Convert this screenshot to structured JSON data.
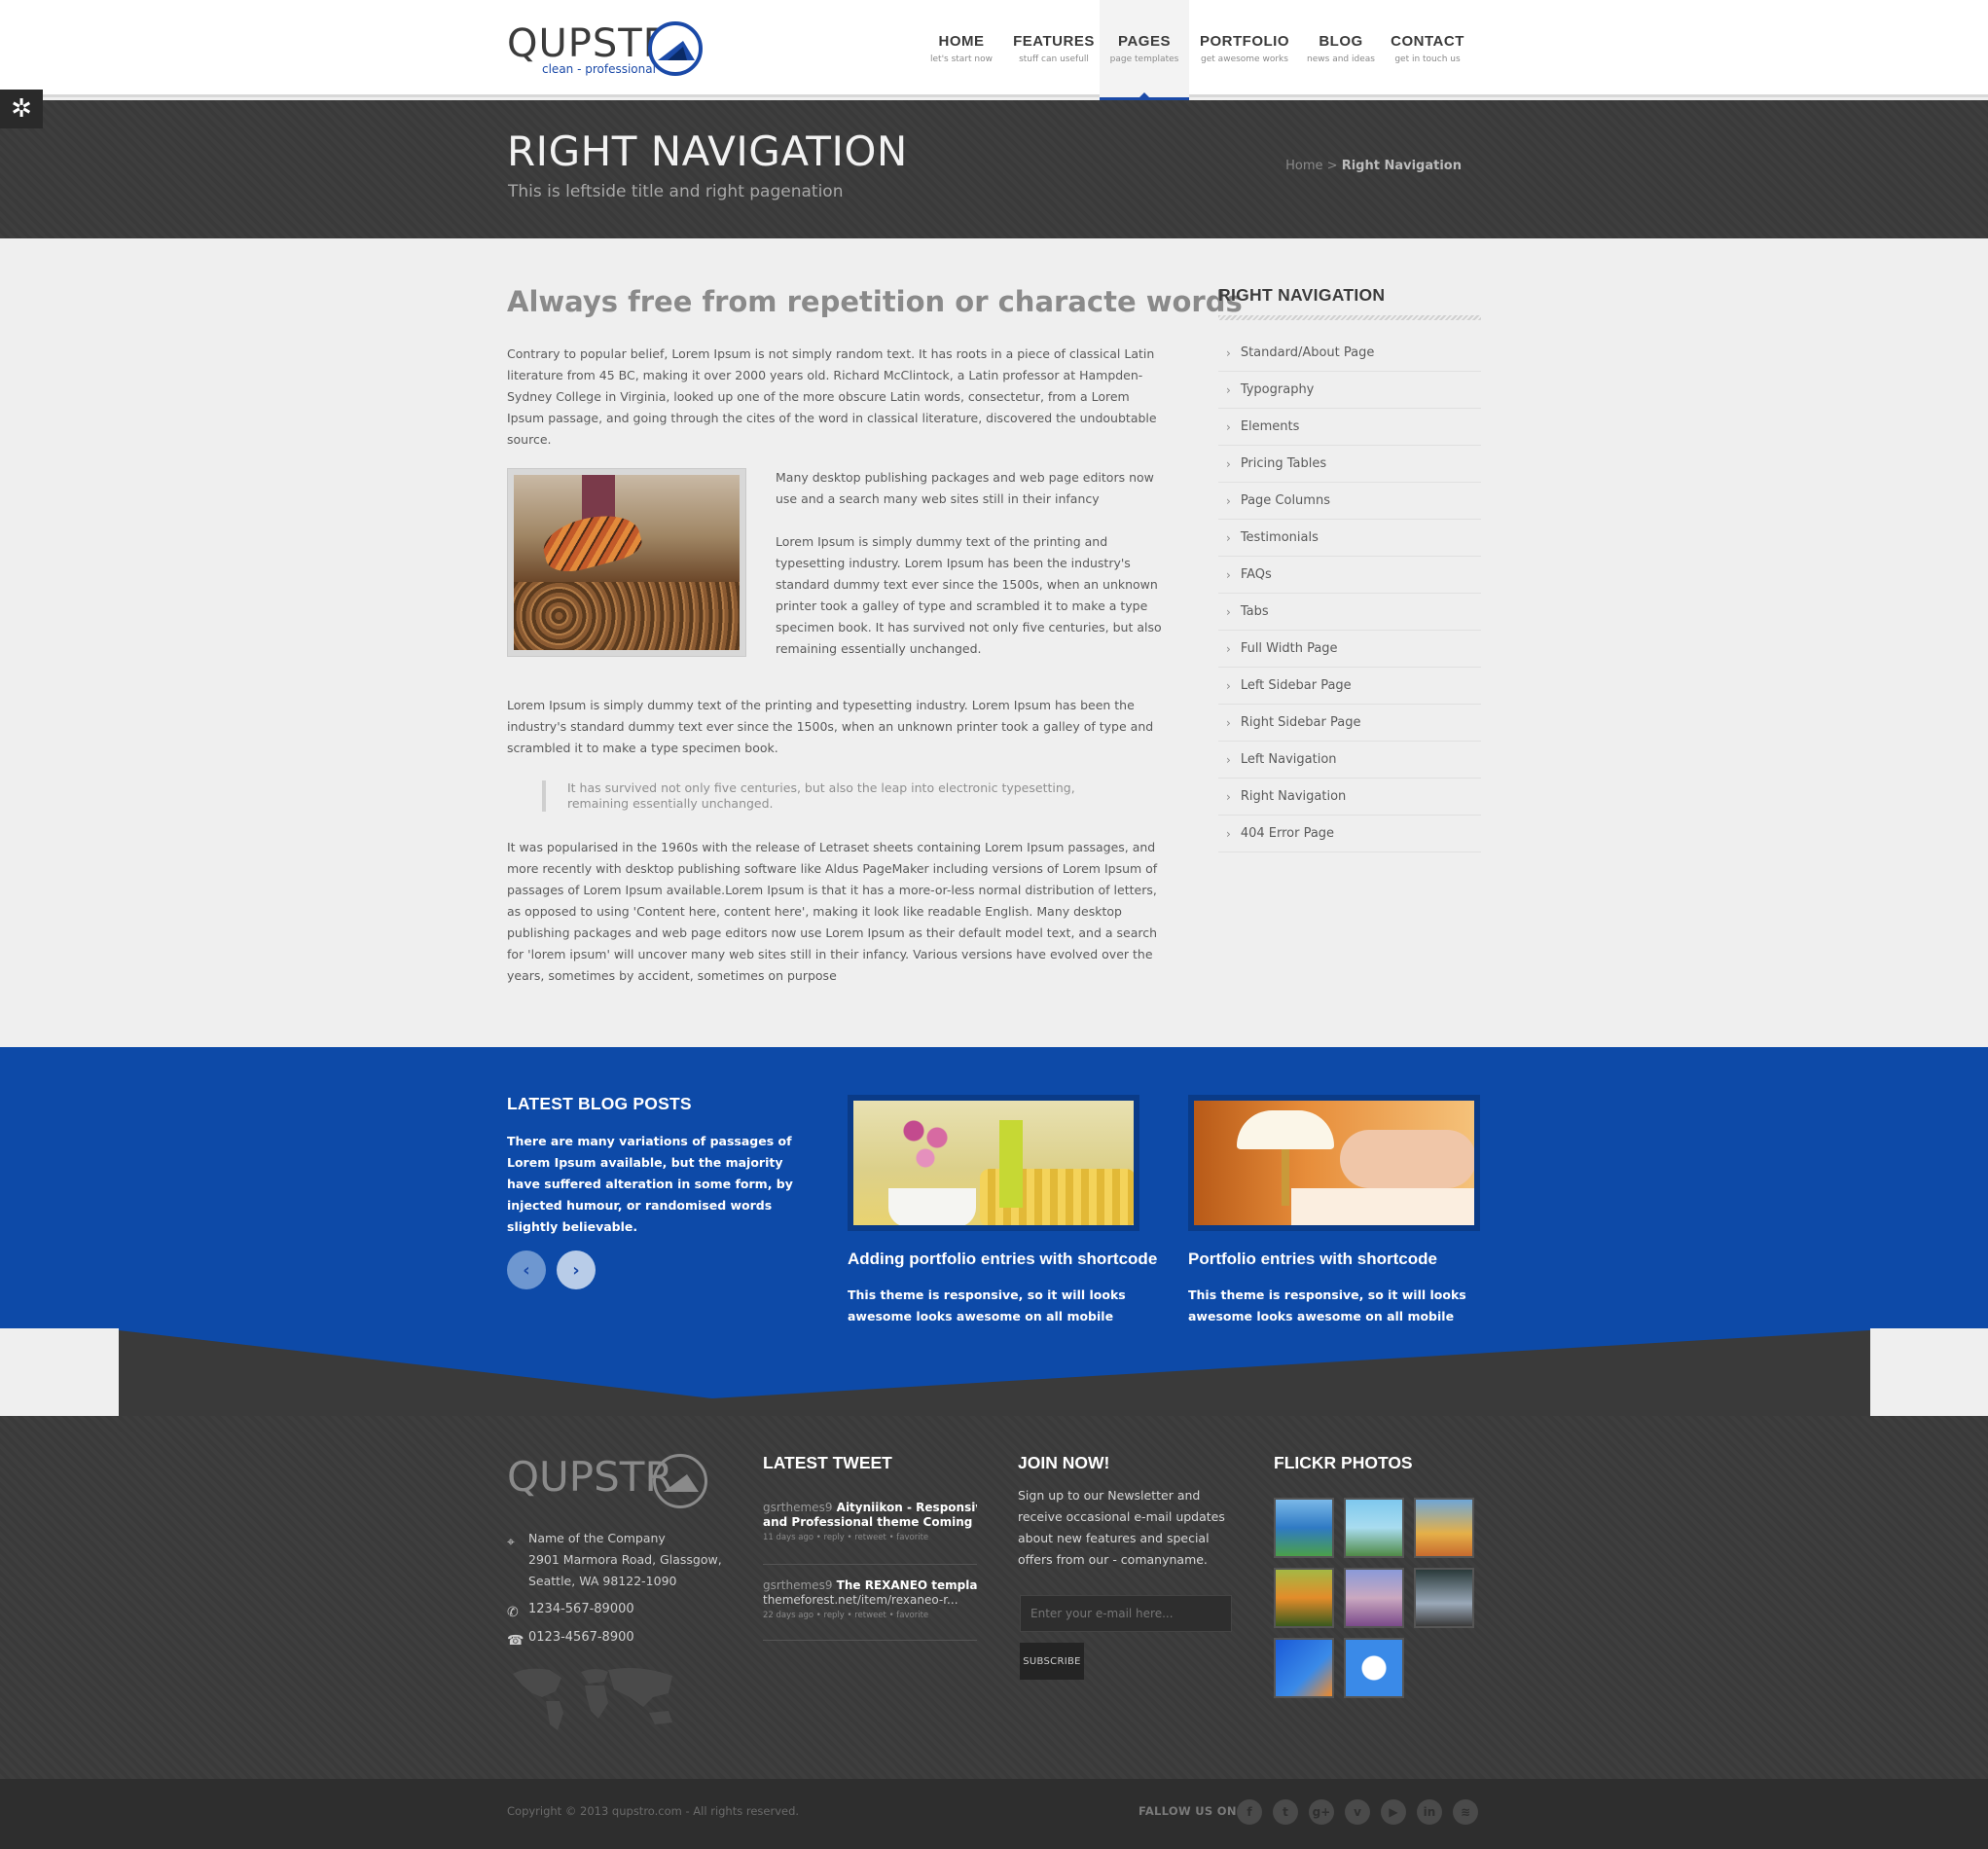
{
  "brand": {
    "name": "QUPSTR",
    "tagline": "clean - professional",
    "accent_color": "#1b4aa8"
  },
  "nav": {
    "items": [
      {
        "label": "HOME",
        "sub": "let's start now"
      },
      {
        "label": "FEATURES",
        "sub": "stuff can usefull"
      },
      {
        "label": "PAGES",
        "sub": "page templates"
      },
      {
        "label": "PORTFOLIO",
        "sub": "get awesome works"
      },
      {
        "label": "BLOG",
        "sub": "news and ideas"
      },
      {
        "label": "CONTACT",
        "sub": "get in touch us"
      }
    ],
    "active_index": 2
  },
  "settings": {
    "icon": "gear-icon"
  },
  "title_bar": {
    "title": "RIGHT NAVIGATION",
    "subtitle": "This is leftside title and right pagenation",
    "breadcrumb_home": "Home",
    "breadcrumb_sep": ">",
    "breadcrumb_current": "Right Navigation"
  },
  "content": {
    "heading": "Always free from repetition or characte words",
    "p1": "Contrary to popular belief, Lorem Ipsum is not simply random text. It has roots in a piece of classical Latin literature from 45 BC, making it over 2000 years old. Richard McClintock, a Latin professor at Hampden-Sydney College in Virginia, looked up one of the more obscure Latin words, consectetur, from a Lorem Ipsum passage, and going through the cites of the word in classical literature, discovered the undoubtable source.",
    "side1": "Many desktop publishing packages and web page editors now use and a search many web sites still in their infancy",
    "side2": "Lorem Ipsum is simply dummy text of the printing and typesetting industry. Lorem Ipsum has been the industry's standard dummy text ever since the 1500s, when an unknown printer took a galley of type and scrambled it to make a type specimen book. It has survived not only five centuries, but also remaining essentially unchanged.",
    "p2": "Lorem Ipsum is simply dummy text of the printing and typesetting industry. Lorem Ipsum has been the industry's standard dummy text ever since the 1500s, when an unknown printer took a galley of type and scrambled it to make a type specimen book.",
    "quote": "It has survived not only five centuries, but also the leap into electronic typesetting, remaining essentially unchanged.",
    "p3": "It was popularised in the 1960s with the release of Letraset sheets containing Lorem Ipsum passages, and more recently with desktop publishing software like Aldus PageMaker including versions of Lorem Ipsum of passages of Lorem Ipsum available.Lorem Ipsum is that it has a more-or-less normal distribution of letters, as opposed to using 'Content here, content here', making it look like readable English. Many desktop publishing packages and web page editors now use Lorem Ipsum as their default model text, and a search for 'lorem ipsum' will uncover many web sites still in their infancy. Various versions have evolved over the years, sometimes by accident, sometimes on purpose"
  },
  "sidebar": {
    "title": "RIGHT NAVIGATION",
    "items": [
      {
        "label": "Standard/About Page"
      },
      {
        "label": "Typography"
      },
      {
        "label": "Elements"
      },
      {
        "label": "Pricing Tables"
      },
      {
        "label": "Page Columns"
      },
      {
        "label": "Testimonials"
      },
      {
        "label": "FAQs"
      },
      {
        "label": "Tabs"
      },
      {
        "label": "Full Width Page"
      },
      {
        "label": "Left Sidebar Page"
      },
      {
        "label": "Right Sidebar Page"
      },
      {
        "label": "Left Navigation"
      },
      {
        "label": "Right Navigation"
      },
      {
        "label": "404 Error Page"
      }
    ]
  },
  "blog": {
    "heading": "LATEST BLOG POSTS",
    "intro": "There are many variations of passages of Lorem Ipsum available, but the majority have suffered alteration in some form, by injected humour, or randomised words slightly believable.",
    "prev_icon": "chevron-left-icon",
    "next_icon": "chevron-right-icon",
    "prev_glyph": "‹",
    "next_glyph": "›",
    "posts": [
      {
        "title": "Adding portfolio entries with shortcode",
        "text": "This theme is responsive, so it will looks awesome looks awesome on all mobile devices."
      },
      {
        "title": "Portfolio entries with shortcode",
        "text": "This theme is responsive, so it will looks awesome looks awesome on all mobile devices."
      }
    ],
    "band_color": "#0d4aa8"
  },
  "footer": {
    "company_name": "Name of the Company",
    "address1": "2901 Marmora Road, Glassgow,",
    "address2": "Seattle, WA 98122-1090",
    "phone": "1234-567-89000",
    "fax": "0123-4567-8900",
    "tweet_heading": "LATEST TWEET",
    "tweets": [
      {
        "user": "gsrthemes9",
        "line1": "Aityniikon - Responsive HTML",
        "line2": "and Professional theme Coming soon.",
        "meta": "11 days ago • reply • retweet • favorite"
      },
      {
        "user": "gsrthemes9",
        "line1": "The REXANEO template o",
        "line2": "themeforest.net/item/rexaneo-r...",
        "meta": "22 days ago • reply • retweet • favorite"
      }
    ],
    "join_heading": "JOIN NOW!",
    "join_text": "Sign up to our Newsletter and receive occasional e-mail updates about new features and special offers from our - comanyname.",
    "email_placeholder": "Enter your e-mail here...",
    "subscribe_label": "SUBSCRIBE",
    "flickr_heading": "FLICKR PHOTOS",
    "copyright": "Copyright © 2013 qupstro.com - All rights reserved.",
    "follow_label": "FALLOW US ON:",
    "social": [
      {
        "icon": "facebook-icon",
        "glyph": "f"
      },
      {
        "icon": "twitter-icon",
        "glyph": "t"
      },
      {
        "icon": "google-plus-icon",
        "glyph": "g+"
      },
      {
        "icon": "vimeo-icon",
        "glyph": "v"
      },
      {
        "icon": "youtube-icon",
        "glyph": "▶"
      },
      {
        "icon": "linkedin-icon",
        "glyph": "in"
      },
      {
        "icon": "rss-icon",
        "glyph": "≋"
      }
    ]
  }
}
